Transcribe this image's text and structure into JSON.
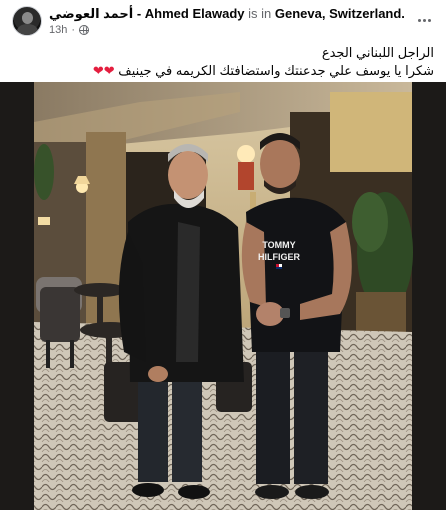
{
  "post": {
    "author_arabic": "أحمد العوضي",
    "separator": "-",
    "author_english": "Ahmed Elawady",
    "location_prefix": "is in",
    "location": "Geneva, Switzerland.",
    "timestamp": "13h",
    "privacy_icon": "globe-icon",
    "more_icon": "more-options-icon",
    "caption_line1": "الراجل اللبناني الجدع",
    "caption_line2": "شكرا يا يوسف علي جدعنتك واستضافتك الكريمه في جينيف",
    "caption_emoji": "❤❤",
    "photo": {
      "shirt_text_line1": "TOMMY",
      "shirt_text_line2": "HILFIGER"
    }
  },
  "colors": {
    "heart": "#e41e3f",
    "muted_text": "#65676b",
    "photo_border": "#1a1816"
  }
}
